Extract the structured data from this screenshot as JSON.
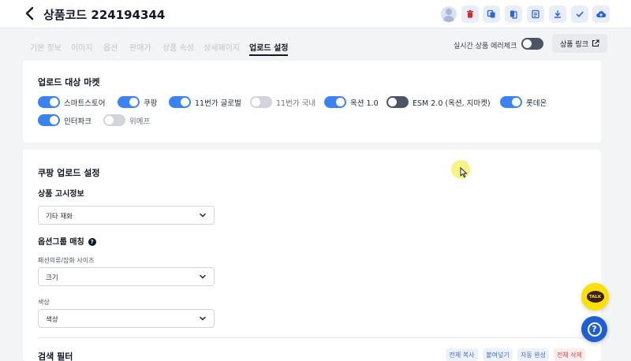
{
  "header": {
    "title": "상품코드 224194344",
    "toolbar_icons": [
      "trash-icon",
      "copy-icon",
      "duplicate-icon",
      "memo-icon",
      "download-icon",
      "check-icon",
      "cloud-upload-icon"
    ],
    "colors": {
      "icon_blue": "#2563eb",
      "icon_red": "#dc2626",
      "icon_bg": "#e8edf7"
    }
  },
  "tabs": [
    "기본 정보",
    "이미지",
    "옵션",
    "판매가",
    "상품 속성",
    "상세페이지",
    "업로드 설정"
  ],
  "active_tab": "업로드 설정",
  "realtime_check": {
    "label": "실시간 상품 에러체크",
    "enabled": false
  },
  "product_link": {
    "label": "상품 링크"
  },
  "upload_markets": {
    "title": "업로드 대상 마켓",
    "items": [
      {
        "label": "스마트스토어",
        "on": true
      },
      {
        "label": "쿠팡",
        "on": true
      },
      {
        "label": "11번가 글로벌",
        "on": true
      },
      {
        "label": "11번가 국내",
        "on": false
      },
      {
        "label": "옥션 1.0",
        "on": true
      },
      {
        "label": "ESM 2.0 (옥션, 지마켓)",
        "on": false
      },
      {
        "label": "롯데온",
        "on": true
      },
      {
        "label": "인터파크",
        "on": true
      },
      {
        "label": "위메프",
        "on": false
      }
    ]
  },
  "coupang": {
    "title": "쿠팡 업로드 설정",
    "notice": {
      "label": "상품 고시정보",
      "value": "기타 재화"
    },
    "option_group": {
      "label": "옵션그룹 매칭",
      "size": {
        "label": "패션의류/잡화 사이즈",
        "value": "크기"
      },
      "color": {
        "label": "색상",
        "value": "색상"
      }
    }
  },
  "search_filter": {
    "title": "검색 필터",
    "buttons": [
      "전체 복사",
      "붙여넣기",
      "자동 완성",
      "전체 삭제"
    ]
  },
  "fabs": {
    "kakao_label": "TALK"
  }
}
